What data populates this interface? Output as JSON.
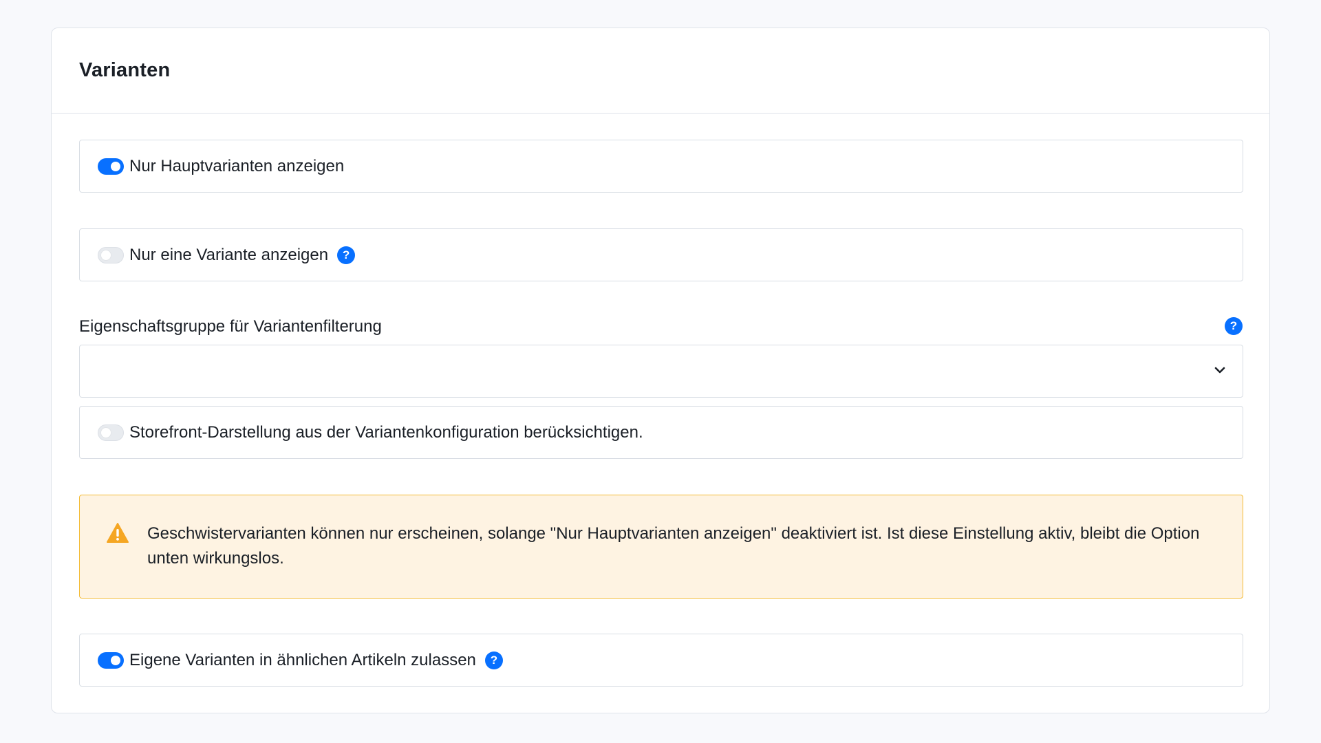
{
  "card": {
    "title": "Varianten"
  },
  "settings": {
    "main_variants": {
      "label": "Nur Hauptvarianten anzeigen",
      "enabled": true
    },
    "single_variant": {
      "label": "Nur eine Variante anzeigen",
      "enabled": false,
      "help_icon": "help-icon"
    },
    "property_group": {
      "label": "Eigenschaftsgruppe für Variantenfilterung",
      "value": "",
      "help_icon": "help-icon",
      "dropdown_icon": "chevron-down-icon"
    },
    "storefront_presentation": {
      "label": "Storefront-Darstellung aus der Variantenkonfiguration berücksichtigen.",
      "enabled": false
    },
    "warning": {
      "icon": "warning-icon",
      "text": "Geschwistervarianten können nur erscheinen, solange \"Nur Hauptvarianten anzeigen\" deaktiviert ist. Ist diese Einstellung aktiv, bleibt die Option unten wirkungslos."
    },
    "own_variants_similar": {
      "label": "Eigene Varianten in ähnlichen Artikeln zulassen",
      "enabled": true,
      "help_icon": "help-icon"
    }
  },
  "colors": {
    "accent": "#0870ff",
    "warning_border": "#f4bb35",
    "warning_bg": "#fef3e2",
    "warning_icon": "#f5a623",
    "border": "#d8dde4"
  },
  "help_glyph": "?"
}
